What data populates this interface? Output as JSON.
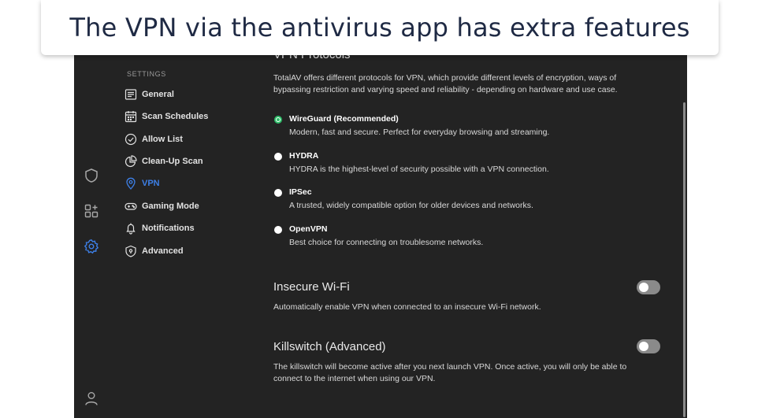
{
  "caption": "The VPN via the antivirus app has extra features",
  "sidebar": {
    "header": "SETTINGS",
    "items": [
      {
        "label": "General",
        "icon": "list-icon"
      },
      {
        "label": "Scan Schedules",
        "icon": "calendar-icon"
      },
      {
        "label": "Allow List",
        "icon": "check-circle-icon"
      },
      {
        "label": "Clean-Up Scan",
        "icon": "pie-chart-icon"
      },
      {
        "label": "VPN",
        "icon": "location-pin-icon",
        "active": true
      },
      {
        "label": "Gaming Mode",
        "icon": "gamepad-icon"
      },
      {
        "label": "Notifications",
        "icon": "bell-icon"
      },
      {
        "label": "Advanced",
        "icon": "shield-advanced-icon"
      }
    ]
  },
  "rail_icons": [
    "shield-icon",
    "apps-grid-icon",
    "gear-icon",
    "user-icon"
  ],
  "vpn_protocols": {
    "title": "VPN Protocols",
    "description": "TotalAV offers different protocols for VPN, which provide different levels of encryption, ways of bypassing restriction and varying speed and reliability - depending on hardware and use case.",
    "options": [
      {
        "name": "WireGuard (Recommended)",
        "description": "Modern, fast and secure. Perfect for everyday browsing and streaming.",
        "selected": true
      },
      {
        "name": "HYDRA",
        "description": "HYDRA is the highest-level of security possible with a VPN connection.",
        "selected": false
      },
      {
        "name": "IPSec",
        "description": "A trusted, widely compatible option for older devices and networks.",
        "selected": false
      },
      {
        "name": "OpenVPN",
        "description": "Best choice for connecting on troublesome networks.",
        "selected": false
      }
    ]
  },
  "insecure_wifi": {
    "title": "Insecure Wi-Fi",
    "description": "Automatically enable VPN when connected to an insecure Wi-Fi network.",
    "enabled": false
  },
  "killswitch": {
    "title": "Killswitch (Advanced)",
    "description": "The killswitch will become active after you next launch VPN. Once active, you will only be able to connect to the internet when using our VPN.",
    "enabled": false
  },
  "colors": {
    "background": "#232323",
    "accent_active": "#3d7fe6",
    "radio_selected": "#2fbf6a",
    "toggle_off": "#8a8a8a"
  }
}
